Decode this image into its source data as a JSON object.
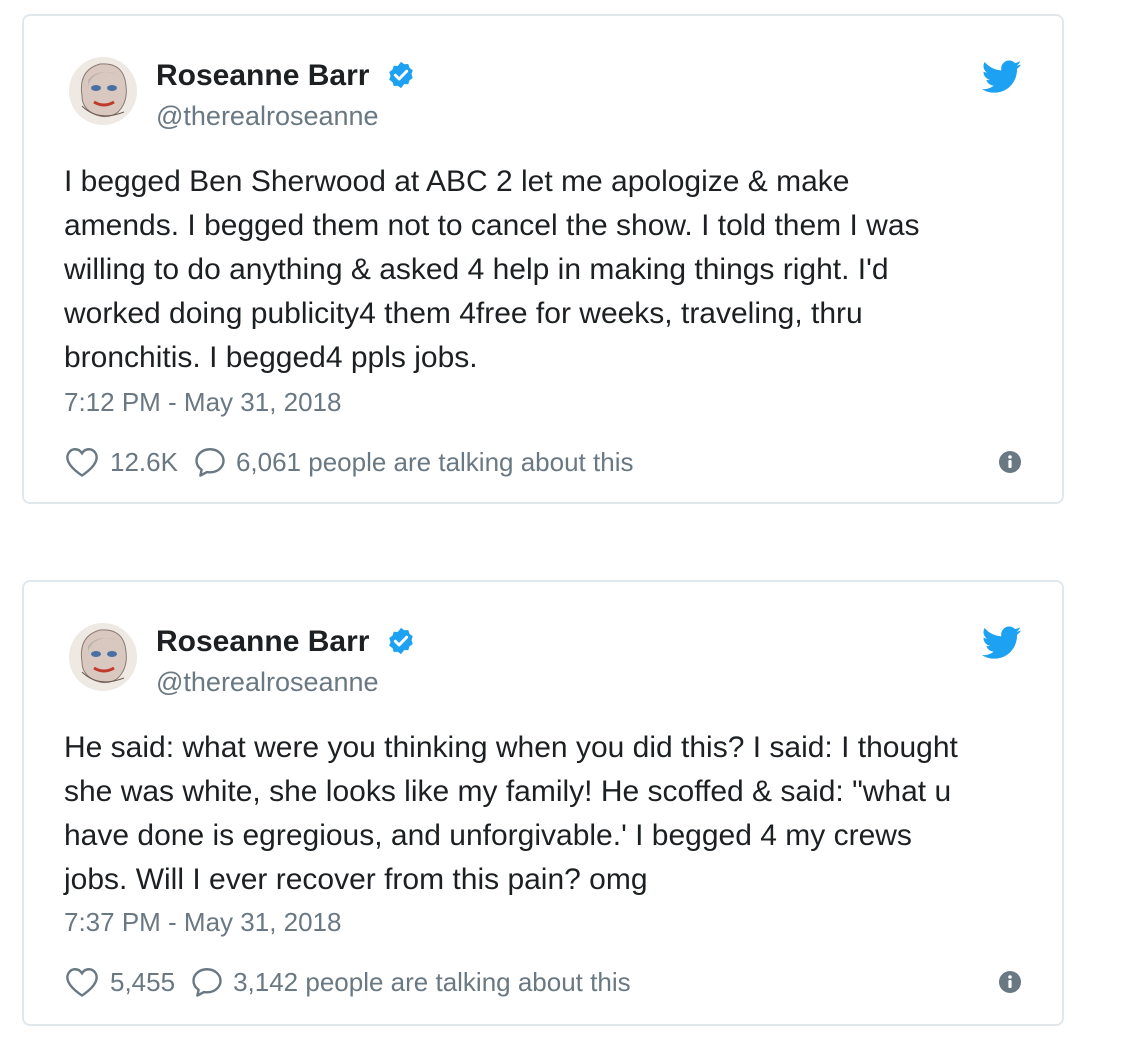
{
  "colors": {
    "twitter_blue": "#1da1f2",
    "text": "#1c2022",
    "muted": "#697882",
    "border": "#e1e8ed"
  },
  "tweets": [
    {
      "display_name": "Roseanne Barr",
      "handle": "@therealroseanne",
      "verified": true,
      "text": "I begged Ben Sherwood at ABC 2 let me apologize & make\namends. I begged them not to cancel the show. I told them I was\nwilling to do anything & asked 4 help in making things right. I'd\nworked doing publicity4 them 4free for weeks, traveling, thru\nbronchitis. I begged4 ppls jobs.",
      "timestamp": "7:12 PM - May 31, 2018",
      "likes": "12.6K",
      "talking": "6,061 people are talking about this",
      "icons": [
        "avatar",
        "verified-badge-icon",
        "twitter-bird-icon",
        "heart-icon",
        "speech-bubble-icon",
        "info-icon"
      ]
    },
    {
      "display_name": "Roseanne Barr",
      "handle": "@therealroseanne",
      "verified": true,
      "text": "He said: what were you thinking when you did this? I said: I thought\nshe was white, she looks like my family! He scoffed & said: \"what u\nhave done is egregious, and unforgivable.' I begged 4 my crews\njobs. Will I ever recover from this pain? omg",
      "timestamp": "7:37 PM - May 31, 2018",
      "likes": "5,455",
      "talking": "3,142 people are talking about this",
      "icons": [
        "avatar",
        "verified-badge-icon",
        "twitter-bird-icon",
        "heart-icon",
        "speech-bubble-icon",
        "info-icon"
      ]
    }
  ]
}
